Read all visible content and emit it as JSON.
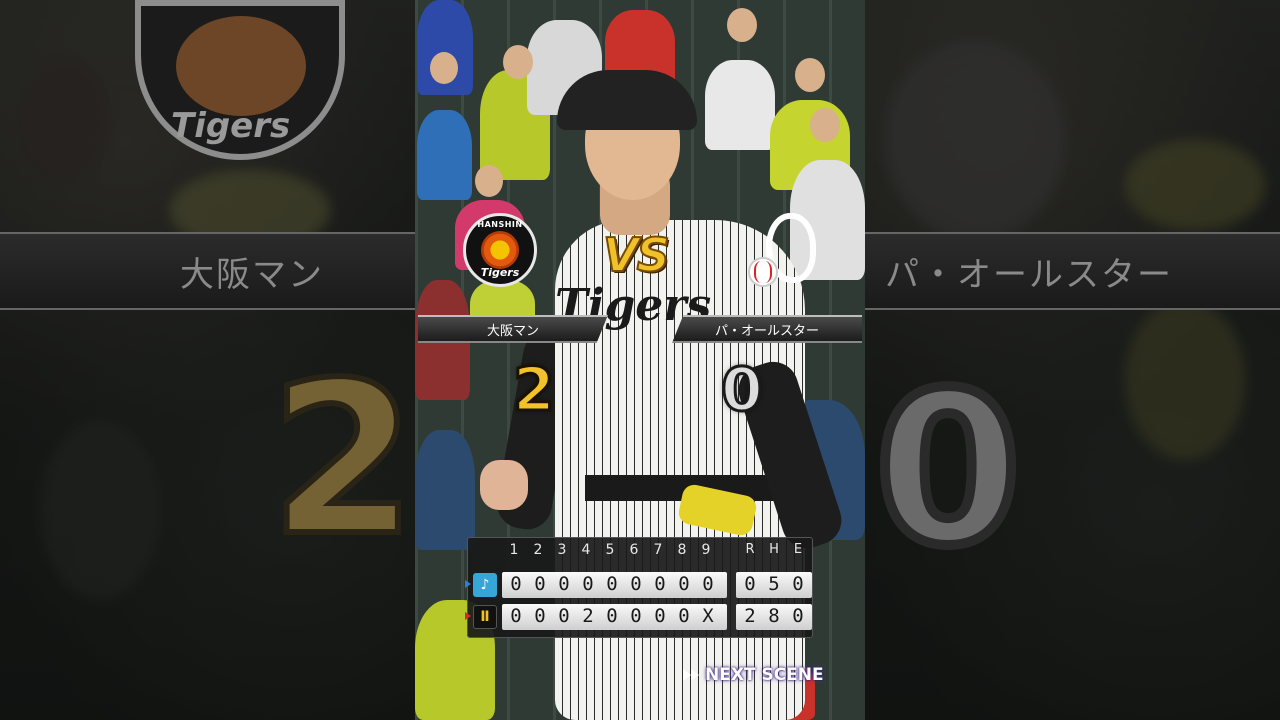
{
  "home_team": {
    "name": "大阪マン",
    "score": "2",
    "logo_top": "HANSHIN",
    "logo_bottom": "Tigers",
    "icon_glyph": "Ⅱ"
  },
  "away_team": {
    "name": "パ・オールスター",
    "score": "0",
    "icon_glyph": "♪"
  },
  "vs_label": "VS",
  "jersey_text": "Tigers",
  "scoreboard": {
    "innings": [
      "1",
      "2",
      "3",
      "4",
      "5",
      "6",
      "7",
      "8",
      "9"
    ],
    "rhe": [
      "R",
      "H",
      "E"
    ],
    "away_line": [
      "0",
      "0",
      "0",
      "0",
      "0",
      "0",
      "0",
      "0",
      "0"
    ],
    "away_totals": [
      "0",
      "5",
      "0"
    ],
    "home_line": [
      "0",
      "0",
      "0",
      "2",
      "0",
      "0",
      "0",
      "0",
      "X"
    ],
    "home_totals": [
      "2",
      "8",
      "0"
    ]
  },
  "next_scene_label": "NEXT SCENE",
  "side_left": {
    "plate_text": "大阪マン",
    "big_num": "2",
    "logo_text": "Tigers"
  },
  "side_right": {
    "plate_text": "パ・オールスター",
    "big_num": "0"
  },
  "colors": {
    "home_score": "#f3c128",
    "away_score": "#dcdcdc",
    "away_icon_bg": "#36a6d8",
    "accent_purple": "#5a3cc0"
  }
}
